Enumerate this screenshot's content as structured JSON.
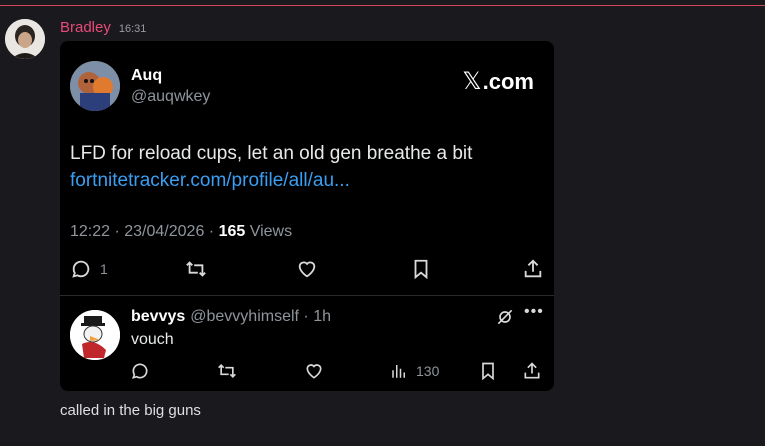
{
  "message": {
    "author": "Bradley",
    "time": "16:31",
    "caption": "called in the big guns"
  },
  "embed": {
    "author_name": "Auq",
    "author_handle": "@auqwkey",
    "site_brand": "𝕏",
    "site_label": ".com",
    "text": "LFD for reload cups,  let an old gen breathe a bit",
    "link": "fortnitetracker.com/profile/all/au...",
    "meta_prefix": "12:22 · 23/04/2026 · ",
    "views_count": "165",
    "views_label": " Views",
    "actions": {
      "reply_count": "1"
    },
    "reply": {
      "name": "bevvys",
      "handle_time": "@bevvyhimself · 1h",
      "text": "vouch",
      "views_count": "130"
    }
  },
  "icons": [
    "reply-icon",
    "retweet-icon",
    "like-icon",
    "bookmark-icon",
    "share-icon",
    "grok-icon",
    "more-icon",
    "views-icon"
  ]
}
